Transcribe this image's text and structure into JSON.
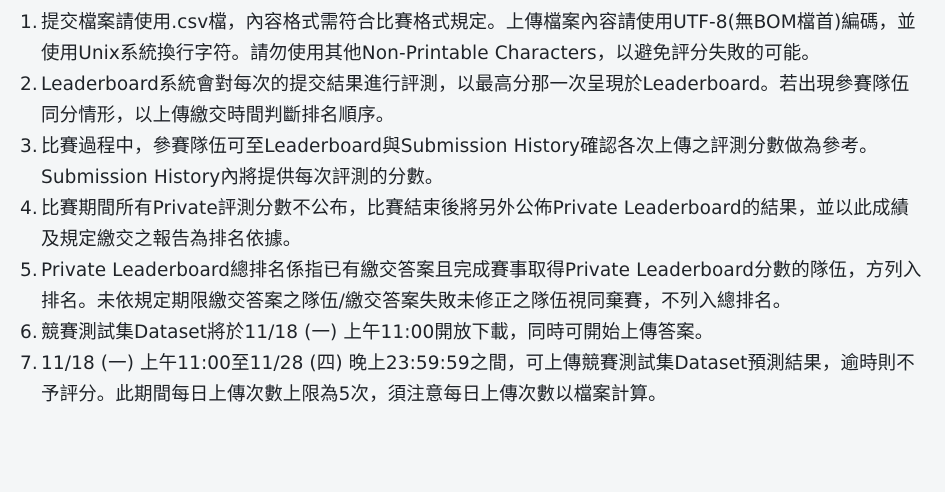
{
  "rules": [
    {
      "number": "1.",
      "text": "提交檔案請使用.csv檔，內容格式需符合比賽格式規定。上傳檔案內容請使用UTF-8(無BOM檔首)編碼，並使用Unix系統換行字符。請勿使用其他Non-Printable Characters，以避免評分失敗的可能。"
    },
    {
      "number": "2.",
      "text": "Leaderboard系統會對每次的提交結果進行評測，以最高分那一次呈現於Leaderboard。若出現參賽隊伍同分情形，以上傳繳交時間判斷排名順序。"
    },
    {
      "number": "3.",
      "text": "比賽過程中，參賽隊伍可至Leaderboard與Submission History確認各次上傳之評測分數做為參考。Submission History內將提供每次評測的分數。"
    },
    {
      "number": "4.",
      "text": "比賽期間所有Private評測分數不公布，比賽結束後將另外公佈Private Leaderboard的結果，並以此成績及規定繳交之報告為排名依據。"
    },
    {
      "number": "5.",
      "text": "Private Leaderboard總排名係指已有繳交答案且完成賽事取得Private Leaderboard分數的隊伍，方列入排名。未依規定期限繳交答案之隊伍/繳交答案失敗未修正之隊伍視同棄賽，不列入總排名。"
    },
    {
      "number": "6.",
      "text": "競賽測試集Dataset將於11/18 (一) 上午11:00開放下載，同時可開始上傳答案。"
    },
    {
      "number": "7.",
      "text": "11/18 (一) 上午11:00至11/28 (四) 晚上23:59:59之間，可上傳競賽測試集Dataset預測結果，逾時則不予評分。此期間每日上傳次數上限為5次，須注意每日上傳次數以檔案計算。"
    }
  ]
}
